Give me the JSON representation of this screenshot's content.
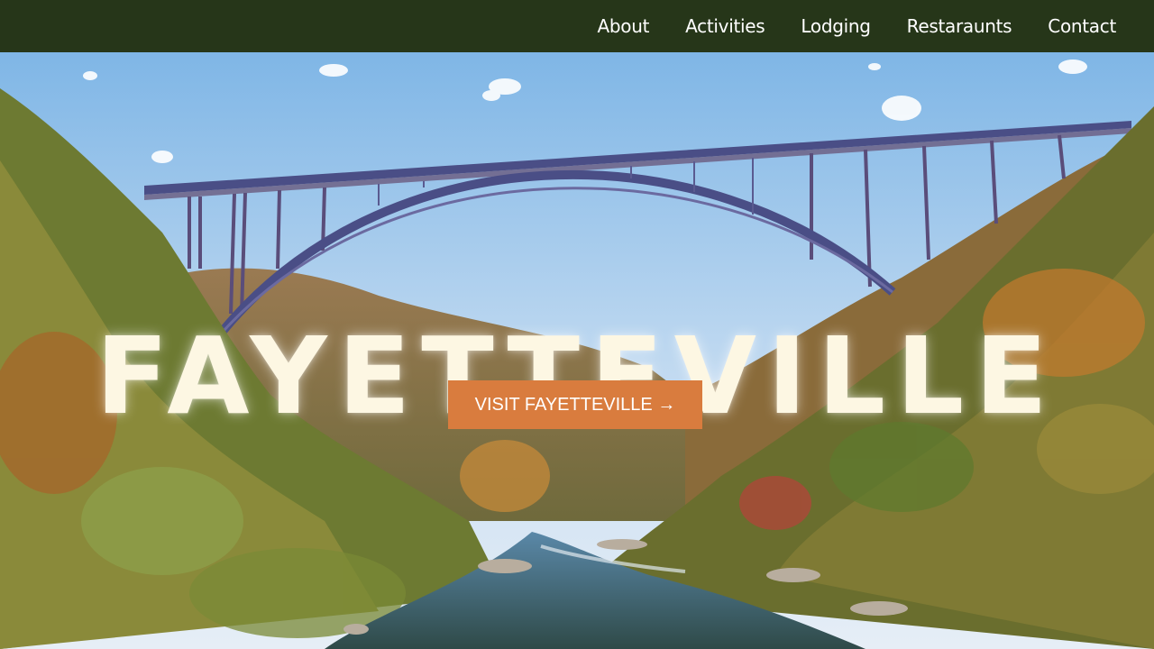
{
  "nav": {
    "items": [
      {
        "label": "About"
      },
      {
        "label": "Activities"
      },
      {
        "label": "Lodging"
      },
      {
        "label": "Restaraunts"
      },
      {
        "label": "Contact"
      }
    ]
  },
  "hero": {
    "title": "FAYETTEVILLE",
    "cta_label": "VISIT FAYETTEVILLE →",
    "image_icon": "bridge-landscape-photo"
  },
  "colors": {
    "nav_bg": "#263619",
    "cta_bg": "#d97c3e",
    "title_color": "#fdf7e3"
  }
}
